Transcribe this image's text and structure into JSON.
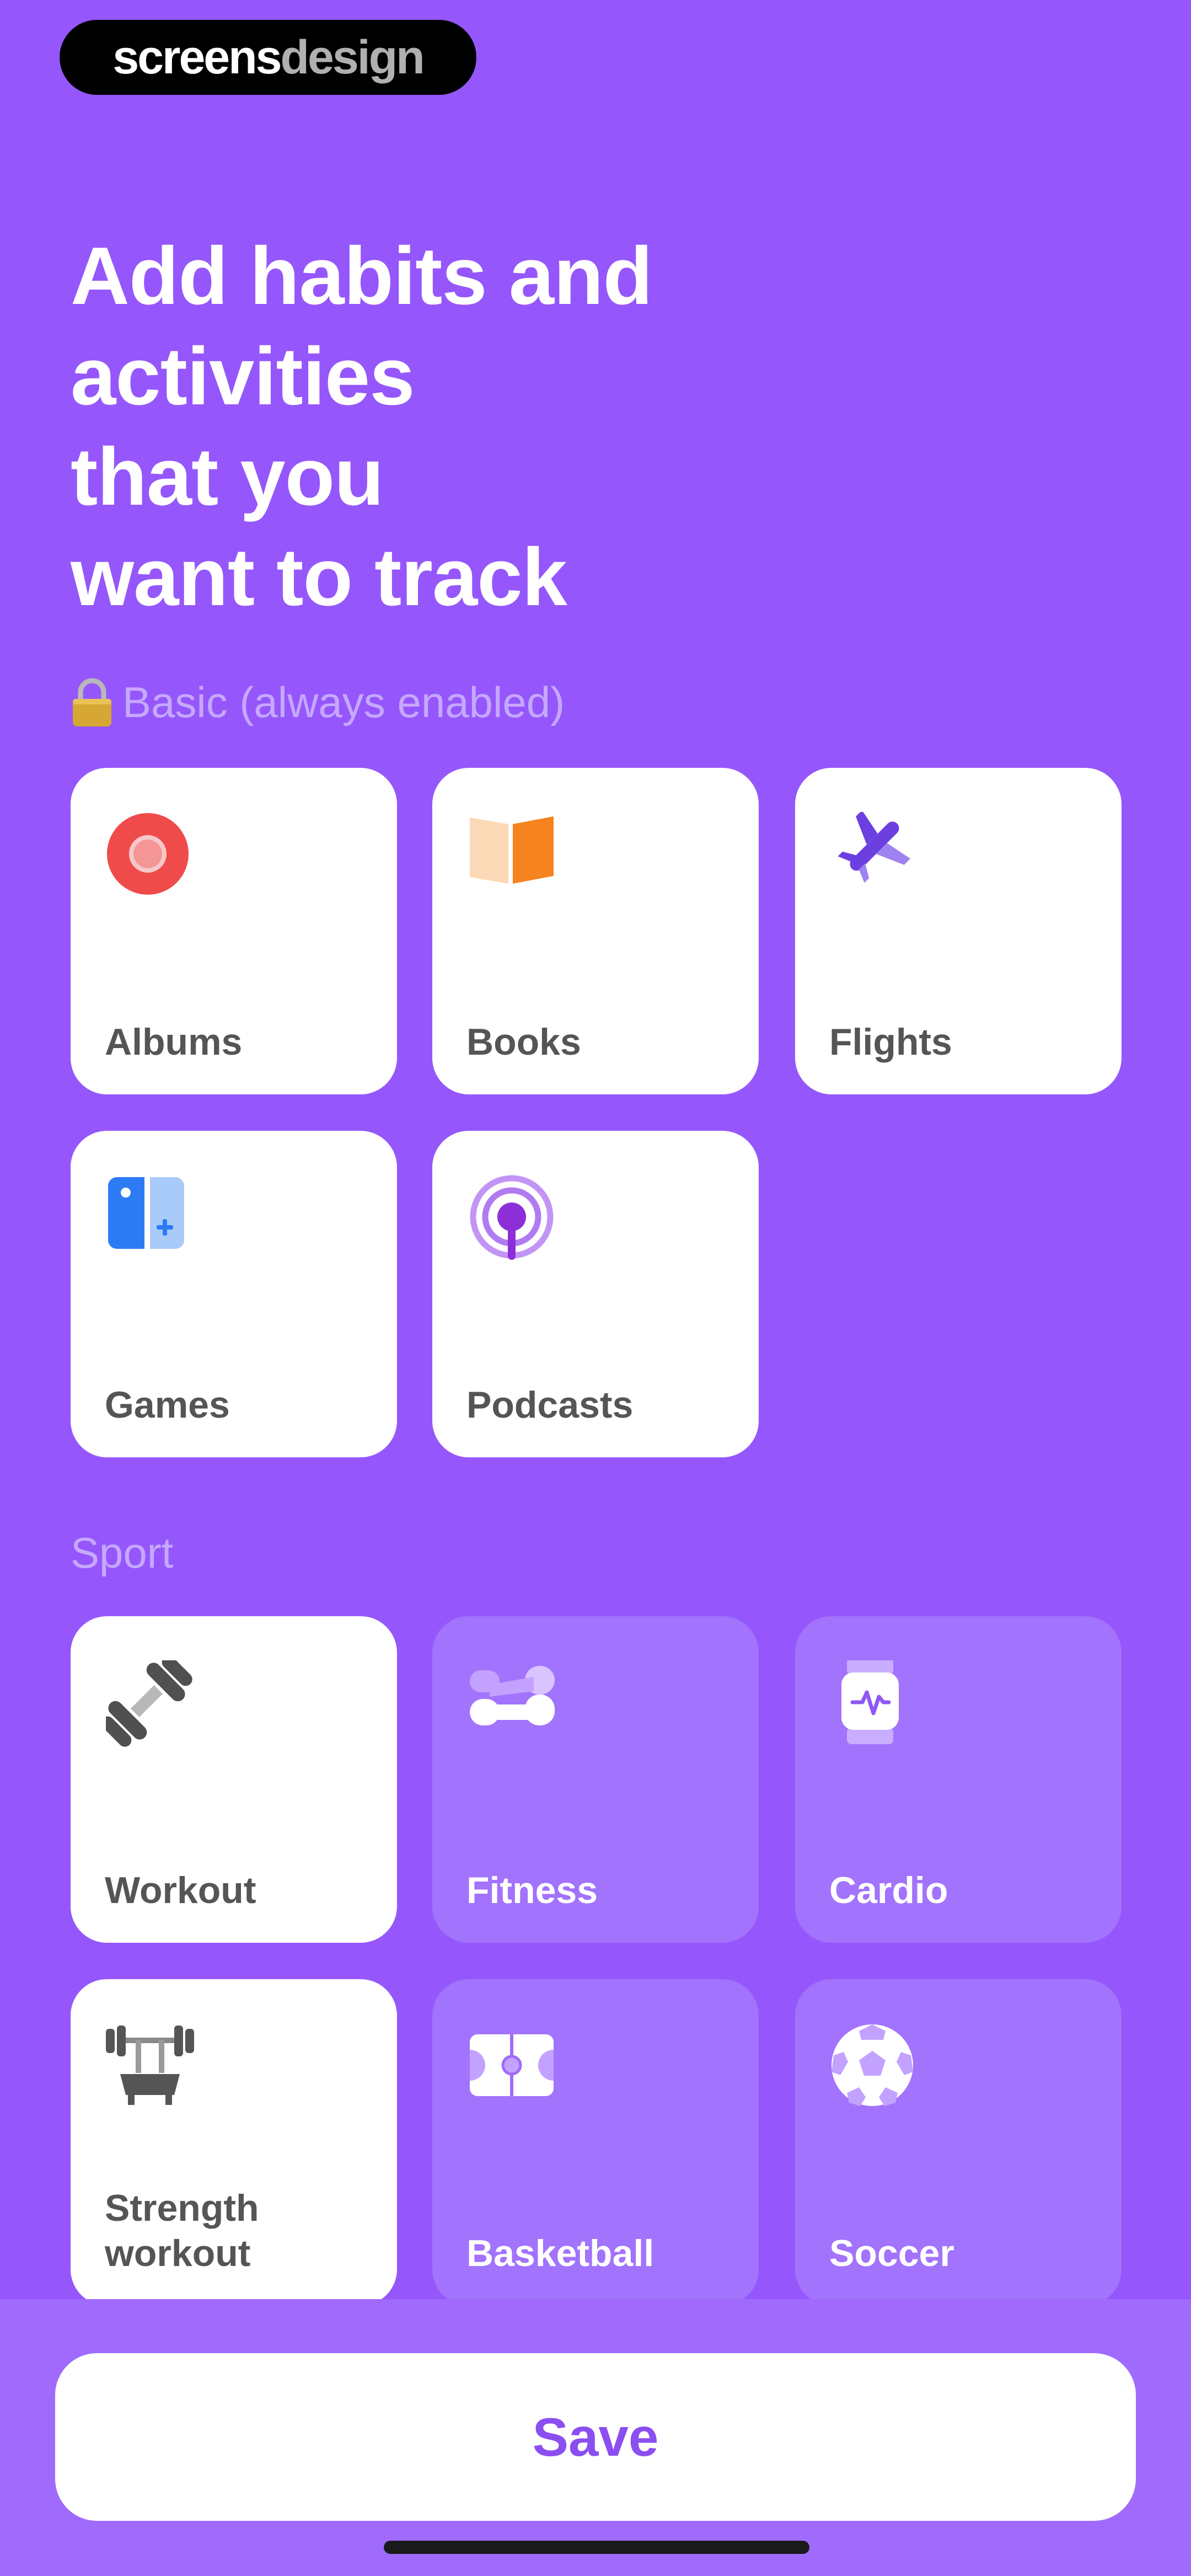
{
  "brand": {
    "part1": "screens",
    "part2": "design"
  },
  "header": {
    "title_lines": [
      "Add habits and",
      "activities",
      "that you",
      "want to track"
    ]
  },
  "sections": {
    "basic": {
      "label": "Basic (always enabled)",
      "lock_icon": "lock-icon",
      "items": [
        {
          "label": "Albums",
          "icon": "record-icon",
          "selected": true
        },
        {
          "label": "Books",
          "icon": "book-icon",
          "selected": true
        },
        {
          "label": "Flights",
          "icon": "airplane-icon",
          "selected": true
        },
        {
          "label": "Games",
          "icon": "game-controller-icon",
          "selected": true
        },
        {
          "label": "Podcasts",
          "icon": "podcast-icon",
          "selected": true
        }
      ]
    },
    "sport": {
      "label": "Sport",
      "items": [
        {
          "label": "Workout",
          "icon": "dumbbell-icon",
          "selected": true
        },
        {
          "label": "Fitness",
          "icon": "fitness-icon",
          "selected": false
        },
        {
          "label": "Cardio",
          "icon": "smartwatch-icon",
          "selected": false
        },
        {
          "label": "Strength workout",
          "label_line1": "Strength",
          "label_line2": "workout",
          "icon": "bench-press-icon",
          "selected": true
        },
        {
          "label": "Basketball",
          "icon": "basketball-court-icon",
          "selected": false
        },
        {
          "label": "Soccer",
          "icon": "soccer-ball-icon",
          "selected": false
        }
      ]
    }
  },
  "footer": {
    "save_label": "Save"
  },
  "colors": {
    "background": "#9557FB",
    "card_selected": "#FFFFFF",
    "card_unselected": "#A273FC",
    "accent_text": "#8B4EF0",
    "section_label": "#C6A8FF"
  }
}
